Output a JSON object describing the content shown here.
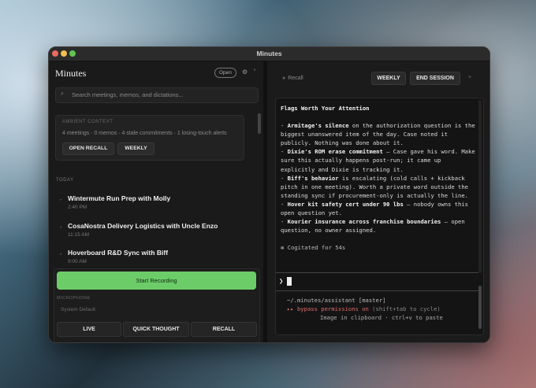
{
  "window": {
    "title": "Minutes"
  },
  "left": {
    "app_title": "Minutes",
    "open_label": "Open",
    "search_placeholder": "Search meetings, memos, and dictations...",
    "ambient": {
      "label": "AMBIENT CONTEXT",
      "stats": "4 meetings · 0 memos · 4 stale commitments · 1 losing-touch alerts",
      "open_recall": "OPEN RECALL",
      "weekly": "WEEKLY"
    },
    "section_label": "TODAY",
    "meetings": [
      {
        "title": "Wintermute Run Prep with Molly",
        "time": "2:40 PM"
      },
      {
        "title": "CosaNostra Delivery Logistics with Uncle Enzo",
        "time": "11:15 AM"
      },
      {
        "title": "Hoverboard R&D Sync with Biff",
        "time": "9:00 AM"
      }
    ],
    "record_label": "Start Recording",
    "mic_label": "MICROPHONE",
    "mic_value": "System Default",
    "buttons": {
      "live": "LIVE",
      "quick_thought": "QUICK THOUGHT",
      "recall": "RECALL"
    }
  },
  "right": {
    "recall_label": "Recall",
    "weekly": "WEEKLY",
    "end_session": "END SESSION",
    "terminal": {
      "heading": "Flags Worth Your Attention",
      "items": [
        {
          "bold": "Armitage's silence",
          "rest": " on the authorization question is the biggest unanswered item of the day. Case noted it publicly. Nothing was done about it."
        },
        {
          "bold": "Dixie's ROM erase commitment",
          "rest": " — Case gave his word. Make sure this actually happens post-run; it came up explicitly and Dixie is tracking it."
        },
        {
          "bold": "Biff's behavior",
          "rest": " is escalating (cold calls + kickback pitch in one meeting). Worth a private word outside the standing sync if procurement-only is actually the line."
        },
        {
          "bold": "Hover kit safety cert under 90 lbs",
          "rest": " — nobody owns this open question yet."
        },
        {
          "bold": "Kourier insurance across franchise boundaries",
          "rest": " — open question, no owner assigned."
        }
      ],
      "cogitated": "Cogitated for 54s",
      "prompt": "❯",
      "path": "~/.minutes/assistant [master]",
      "bypass": "▸▸ bypass permissions on",
      "bypass_hint": " (shift+tab to cycle)",
      "clipboard": "Image in clipboard · ctrl+v to paste"
    }
  }
}
